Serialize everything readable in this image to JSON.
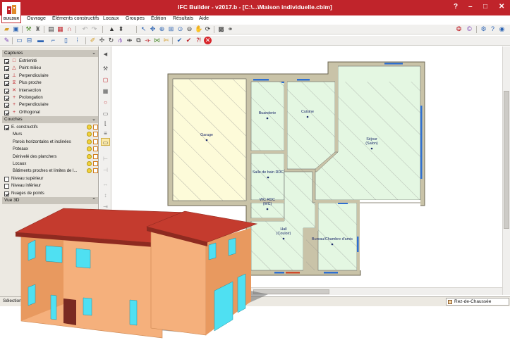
{
  "window": {
    "title": "IFC Builder - v2017.b - [C:\\...\\Maison individuelle.cbim]",
    "controls": [
      "?",
      "–",
      "□",
      "✕"
    ],
    "accent": "#c0242b"
  },
  "logo": {
    "text": "BUILDER"
  },
  "menu": [
    "Ouvrage",
    "Éléments constructifs",
    "Locaux",
    "Groupes",
    "Édition",
    "Résultats",
    "Aide"
  ],
  "panel": {
    "captures_header": "Captures",
    "captures": [
      {
        "label": "Extrémité",
        "checked": true,
        "icon": "endpoint-icon",
        "glyph": "□"
      },
      {
        "label": "Point milieu",
        "checked": true,
        "icon": "midpoint-icon",
        "glyph": "△"
      },
      {
        "label": "Perpendiculaire",
        "checked": true,
        "icon": "perpendicular-icon",
        "glyph": "⊥"
      },
      {
        "label": "Plus proche",
        "checked": true,
        "icon": "nearest-icon",
        "glyph": "⧖"
      },
      {
        "label": "Intersection",
        "checked": true,
        "icon": "intersection-icon",
        "glyph": "✕"
      },
      {
        "label": "Prolongation",
        "checked": true,
        "icon": "extension-icon",
        "glyph": "+"
      },
      {
        "label": "Perpendiculaire",
        "checked": true,
        "icon": "perpendicular-cross-icon",
        "glyph": "+"
      },
      {
        "label": "Orthogonal",
        "checked": true,
        "icon": "orthogonal-icon",
        "glyph": "+"
      }
    ],
    "couches_header": "Couches",
    "couches": [
      {
        "label": "E. constructifs",
        "checked": true,
        "indent": false
      },
      {
        "label": "Murs",
        "checked": null,
        "indent": true
      },
      {
        "label": "Parois horizontales et inclinées",
        "checked": null,
        "indent": true
      },
      {
        "label": "Poteaux",
        "checked": null,
        "indent": true
      },
      {
        "label": "Dénivelé des planchers",
        "checked": null,
        "indent": true
      },
      {
        "label": "Locaux",
        "checked": null,
        "indent": true
      },
      {
        "label": "Bâtiments proches et limites de l...",
        "checked": null,
        "indent": true
      }
    ],
    "niveaux": [
      {
        "label": "Niveau supérieur",
        "checked": false
      },
      {
        "label": "Niveau inférieur",
        "checked": false
      },
      {
        "label": "Nuages de points",
        "checked": true
      }
    ],
    "vue3d_header": "Vue 3D"
  },
  "plan": {
    "rooms": [
      {
        "name": "Garage",
        "lines": [
          "Garage"
        ]
      },
      {
        "name": "Buanderie",
        "lines": [
          "Buanderie"
        ]
      },
      {
        "name": "Cuisine",
        "lines": [
          "Cuisine"
        ]
      },
      {
        "name": "Séjour",
        "lines": [
          "Séjour",
          "(Salon)"
        ]
      },
      {
        "name": "Salle de bain RDC",
        "lines": [
          "Salle de bain RDC"
        ]
      },
      {
        "name": "WC RDC",
        "lines": [
          "WC RDC",
          "(WC)"
        ]
      },
      {
        "name": "Hall",
        "lines": [
          "Hall",
          "(Couloir)"
        ]
      },
      {
        "name": "Bureau/Chambre d'amis",
        "lines": [
          "Bureau/Chambre d'amis"
        ]
      }
    ],
    "colors": {
      "wall": "#c9c3a8",
      "garage_fill": "#fdfbd9",
      "room_fill": "#e4f7e2",
      "window": "#2f6fd0",
      "hatch": "#8a8a8a"
    }
  },
  "status": {
    "left": "Sélection",
    "level": "Rez-de-Chaussée"
  },
  "house_colors": {
    "roof": "#c43b2e",
    "roof_dark": "#8e2a20",
    "wall": "#f5b07c",
    "wall_shade": "#e8995f",
    "window": "#4fe0f2"
  }
}
